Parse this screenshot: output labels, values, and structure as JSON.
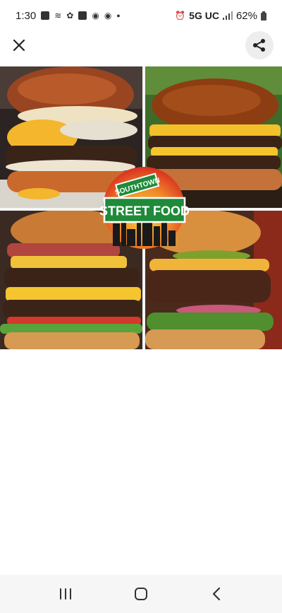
{
  "status_bar": {
    "time": "1:30",
    "network": "5G UC",
    "battery": "62%",
    "notification_icons": [
      "stocks-app-icon",
      "wifi-calling-icon",
      "pinwheel-icon",
      "s-app-icon",
      "chrome-icon",
      "chrome-icon",
      "more-dot-icon"
    ]
  },
  "toolbar": {
    "close_icon": "close-icon",
    "share_icon": "share-icon"
  },
  "image": {
    "description_icon": "burger-collage",
    "logo_top": "SOUTHTOWN",
    "logo_main": "STREET FOOD"
  },
  "navigation": {
    "recents_icon": "recent-apps-icon",
    "home_icon": "home-icon",
    "back_icon": "back-icon"
  },
  "colors": {
    "logo_green": "#1f8a3a",
    "sunset_red": "#e8412a",
    "sunset_yellow": "#f7b52a",
    "share_bg": "#ededed"
  }
}
